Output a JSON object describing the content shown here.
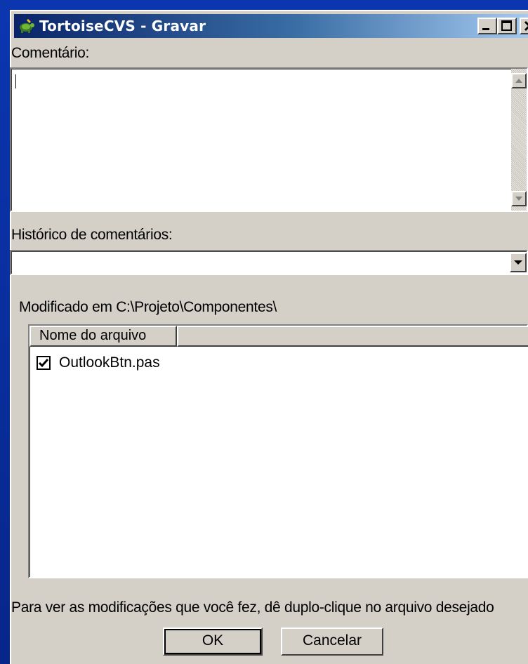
{
  "window": {
    "title": "TortoiseCVS - Gravar",
    "app_icon": "tortoise-icon"
  },
  "titlebar_buttons": {
    "minimize": "minimize-icon",
    "maximize": "maximize-icon",
    "close": "close-icon"
  },
  "comment": {
    "label": "Comentário:",
    "value": ""
  },
  "history": {
    "label": "Histórico de comentários:",
    "selected": ""
  },
  "files": {
    "location_label": "Modificado em C:\\Projeto\\Componentes\\",
    "columns": [
      "Nome do arquivo",
      ""
    ],
    "rows": [
      {
        "checked": true,
        "name": "OutlookBtn.pas"
      }
    ]
  },
  "hint": "Para ver as modificações que você fez, dê duplo-clique no arquivo desejado",
  "buttons": {
    "ok": "OK",
    "cancel": "Cancelar"
  },
  "colors": {
    "titlebar_start": "#0a246a",
    "titlebar_end": "#a6caf0",
    "face": "#d4d0c8",
    "desktop": "#0b36b0"
  }
}
